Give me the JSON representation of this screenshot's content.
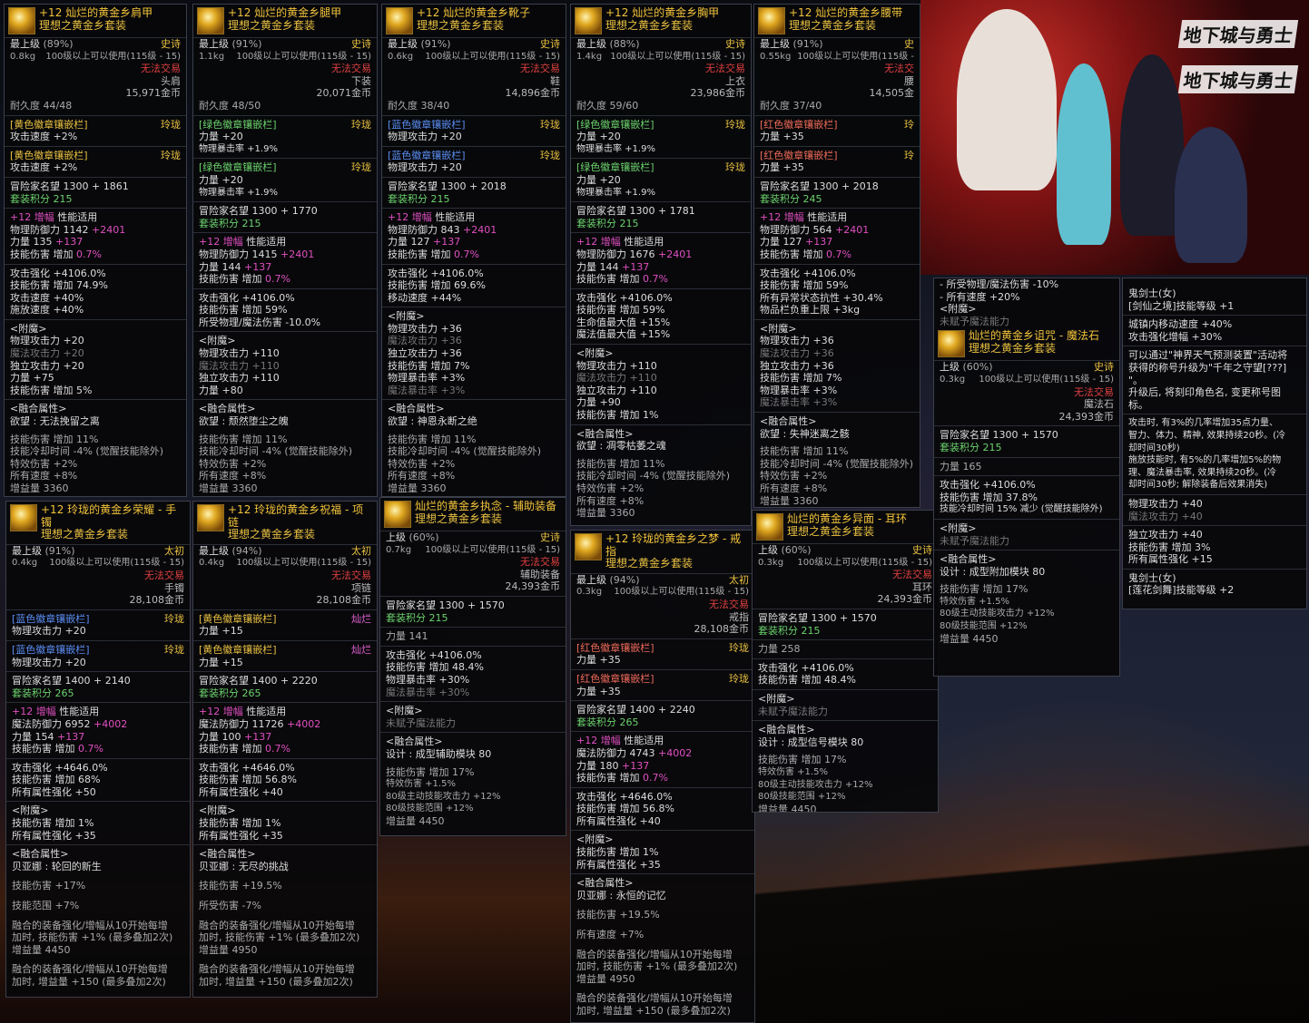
{
  "banner": {
    "logo1": "地下城与勇士",
    "logo2": "地下城与勇士"
  },
  "p1": {
    "title": "+12 灿烂的黄金乡肩甲",
    "set": "理想之黄金乡套装",
    "grade": "最上级",
    "pct": "(89%)",
    "rarity": "史诗",
    "weight": "0.8kg",
    "level_req": "100级以上可以使用(115级 - 15)",
    "trade": "无法交易",
    "slot": "头肩",
    "price": "15,971金币",
    "dur": "耐久度 44/48",
    "s1": "[黄色徽章镶嵌栏]",
    "s1tag": "玲珑",
    "s1v": "攻击速度 +2%",
    "s2": "[黄色徽章镶嵌栏]",
    "s2tag": "玲珑",
    "s2v": "攻击速度 +2%",
    "fame": "冒险家名望 1300 + 1861",
    "setpt": "套装积分 215",
    "amp": "+12 增幅",
    "ampx": "性能适用",
    "l1": "物理防御力 1142",
    "l1b": "+2401",
    "l2": "力量 135",
    "l2b": "+137",
    "l3": "技能伤害 增加",
    "l3b": "0.7%",
    "l4": "攻击强化 +4106.0%",
    "l5": "技能伤害 增加 74.9%",
    "l6": "攻击速度 +40%",
    "l7": "施放速度 +40%",
    "ench": "<附魔>",
    "e1": "物理攻击力 +20",
    "e2": "魔法攻击力 +20",
    "e3": "独立攻击力 +20",
    "e4": "力量 +75",
    "e5": "技能伤害 增加 5%",
    "fuse": "<融合属性>",
    "fuse1": "欲望 : 无法挽留之离",
    "f1": "技能伤害 增加 11%",
    "f2": "技能冷却时间 -4% (觉醒技能除外)",
    "f3": "特效伤害 +2%",
    "f4": "所有速度 +8%",
    "f5": "增益量 3360"
  },
  "p2": {
    "title": "+12 灿烂的黄金乡腿甲",
    "set": "理想之黄金乡套装",
    "grade": "最上级",
    "pct": "(91%)",
    "rarity": "史诗",
    "weight": "1.1kg",
    "level_req": "100级以上可以使用(115级 - 15)",
    "trade": "无法交易",
    "slot": "下装",
    "price": "20,071金币",
    "dur": "耐久度 48/50",
    "s1": "[绿色徽章镶嵌栏]",
    "s1tag": "玲珑",
    "s1v": "力量 +20",
    "s1w": "物理暴击率 +1.9%",
    "s2": "[绿色徽章镶嵌栏]",
    "s2tag": "玲珑",
    "s2v": "力量 +20",
    "s2w": "物理暴击率 +1.9%",
    "fame": "冒险家名望 1300 + 1770",
    "setpt": "套装积分 215",
    "amp": "+12 增幅",
    "ampx": "性能适用",
    "l1": "物理防御力 1415",
    "l1b": "+2401",
    "l2": "力量 144",
    "l2b": "+137",
    "l3": "技能伤害 增加",
    "l3b": "0.7%",
    "l4": "攻击强化 +4106.0%",
    "l5": "技能伤害 增加 59%",
    "l6": "所受物理/魔法伤害 -10.0%",
    "ench": "<附魔>",
    "e1": "物理攻击力 +110",
    "e2": "魔法攻击力 +110",
    "e3": "独立攻击力 +110",
    "e4": "力量 +80",
    "fuse": "<融合属性>",
    "fuse1": "欲望 : 颓然堕尘之魄",
    "f1": "技能伤害 增加 11%",
    "f2": "技能冷却时间 -4% (觉醒技能除外)",
    "f3": "特效伤害 +2%",
    "f4": "所有速度 +8%",
    "f5": "增益量 3360"
  },
  "p3": {
    "title": "+12 灿烂的黄金乡靴子",
    "set": "理想之黄金乡套装",
    "grade": "最上级",
    "pct": "(91%)",
    "rarity": "史诗",
    "weight": "0.6kg",
    "level_req": "100级以上可以使用(115级 - 15)",
    "trade": "无法交易",
    "slot": "鞋",
    "price": "14,896金币",
    "dur": "耐久度 38/40",
    "s1": "[蓝色徽章镶嵌栏]",
    "s1tag": "玲珑",
    "s1v": "物理攻击力 +20",
    "s2": "[蓝色徽章镶嵌栏]",
    "s2tag": "玲珑",
    "s2v": "物理攻击力 +20",
    "fame": "冒险家名望 1300 + 2018",
    "setpt": "套装积分 215",
    "amp": "+12 增幅",
    "ampx": "性能适用",
    "l1": "物理防御力 843",
    "l1b": "+2401",
    "l2": "力量 127",
    "l2b": "+137",
    "l3": "技能伤害 增加",
    "l3b": "0.7%",
    "l4": "攻击强化 +4106.0%",
    "l5": "技能伤害 增加 69.6%",
    "l6": "移动速度 +44%",
    "ench": "<附魔>",
    "e1": "物理攻击力 +36",
    "e2": "魔法攻击力 +36",
    "e3": "独立攻击力 +36",
    "e4": "技能伤害 增加 7%",
    "e5": "物理暴击率 +3%",
    "e6": "魔法暴击率 +3%",
    "fuse": "<融合属性>",
    "fuse1": "欲望 : 神恩永断之绝",
    "f1": "技能伤害 增加 11%",
    "f2": "技能冷却时间 -4% (觉醒技能除外)",
    "f3": "特效伤害 +2%",
    "f4": "所有速度 +8%",
    "f5": "增益量 3360"
  },
  "p4": {
    "title": "+12 灿烂的黄金乡胸甲",
    "set": "理想之黄金乡套装",
    "grade": "最上级",
    "pct": "(88%)",
    "rarity": "史诗",
    "weight": "1.4kg",
    "level_req": "100级以上可以使用(115级 - 15)",
    "trade": "无法交易",
    "slot": "上衣",
    "price": "23,986金币",
    "dur": "耐久度 59/60",
    "s1": "[绿色徽章镶嵌栏]",
    "s1tag": "玲珑",
    "s1v": "力量 +20",
    "s1w": "物理暴击率 +1.9%",
    "s2": "[绿色徽章镶嵌栏]",
    "s2tag": "玲珑",
    "s2v": "力量 +20",
    "s2w": "物理暴击率 +1.9%",
    "fame": "冒险家名望 1300 + 1781",
    "setpt": "套装积分 215",
    "amp": "+12 增幅",
    "ampx": "性能适用",
    "l1": "物理防御力 1676",
    "l1b": "+2401",
    "l2": "力量 144",
    "l2b": "+137",
    "l3": "技能伤害 增加",
    "l3b": "0.7%",
    "l4": "攻击强化 +4106.0%",
    "l5": "技能伤害 增加 59%",
    "l6": "生命值最大值 +15%",
    "l7": "魔法值最大值 +15%",
    "ench": "<附魔>",
    "e1": "物理攻击力 +110",
    "e2": "魔法攻击力 +110",
    "e3": "独立攻击力 +110",
    "e4": "力量 +90",
    "e5": "技能伤害 增加 1%",
    "fuse": "<融合属性>",
    "fuse1": "欲望 : 凋零枯萎之魂",
    "f1": "技能伤害 增加 11%",
    "f2": "技能冷却时间 -4% (觉醒技能除外)",
    "f3": "特效伤害 +2%",
    "f4": "所有速度 +8%",
    "f5": "增益量 3360"
  },
  "p5": {
    "title": "+12 灿烂的黄金乡腰带",
    "set": "理想之黄金乡套装",
    "grade": "最上级",
    "pct": "(91%)",
    "rarity": "史",
    "weight": "0.55kg",
    "level_req": "100级以上可以使用(115级 -",
    "trade": "无法交",
    "slot": "腰",
    "price": "14,505金",
    "dur": "耐久度 37/40",
    "s1": "[红色徽章镶嵌栏]",
    "s1tag": "玲",
    "s1v": "力量 +35",
    "s2": "[红色徽章镶嵌栏]",
    "s2tag": "玲",
    "s2v": "力量 +35",
    "fame": "冒险家名望 1300 + 2018",
    "setpt": "套装积分 245",
    "amp": "+12 增幅",
    "ampx": "性能适用",
    "l1": "物理防御力 564",
    "l1b": "+2401",
    "l2": "力量 127",
    "l2b": "+137",
    "l3": "技能伤害 增加",
    "l3b": "0.7%",
    "l4": "攻击强化 +4106.0%",
    "l5": "技能伤害 增加 59%",
    "l6": "所有异常状态抗性 +30.4%",
    "l7": "物品栏负重上限 +3kg",
    "ench": "<附魔>",
    "e1": "物理攻击力 +36",
    "e2": "魔法攻击力 +36",
    "e3": "独立攻击力 +36",
    "e4": "技能伤害 增加 7%",
    "e5": "物理暴击率 +3%",
    "e6": "魔法暴击率 +3%",
    "fuse": "<融合属性>",
    "fuse1": "欲望 : 失神迷离之骸",
    "f1": "技能伤害 增加 11%",
    "f2": "技能冷却时间 -4% (觉醒技能除外)",
    "f3": "特效伤害 +2%",
    "f4": "所有速度 +8%",
    "f5": "增益量 3360"
  },
  "p6": {
    "title": "+12 玲珑的黄金乡荣耀 - 手镯",
    "set": "理想之黄金乡套装",
    "grade": "最上级",
    "pct": "(91%)",
    "rarity": "太初",
    "weight": "0.4kg",
    "level_req": "100级以上可以使用(115级 - 15)",
    "trade": "无法交易",
    "slot": "手镯",
    "price": "28,108金币",
    "s1": "[蓝色徽章镶嵌栏]",
    "s1tag": "玲珑",
    "s1v": "物理攻击力 +20",
    "s2": "[蓝色徽章镶嵌栏]",
    "s2tag": "玲珑",
    "s2v": "物理攻击力 +20",
    "fame": "冒险家名望 1400 + 2140",
    "setpt": "套装积分 265",
    "amp": "+12 增幅",
    "ampx": "性能适用",
    "l1": "魔法防御力 6952",
    "l1b": "+4002",
    "l2": "力量 154",
    "l2b": "+137",
    "l3": "技能伤害 增加",
    "l3b": "0.7%",
    "l4": "攻击强化 +4646.0%",
    "l5": "技能伤害 增加 68%",
    "l6": "所有属性强化 +50",
    "ench": "<附魔>",
    "e1": "技能伤害 增加 1%",
    "e2": "所有属性强化 +35",
    "fuse": "<融合属性>",
    "fuse1": "贝亚娜 : 轮回的新生",
    "f1": "技能伤害 +17%",
    "f2": "技能范围 +7%",
    "g1": "融合的装备强化/增幅从10开始每增",
    "g2": "加时, 技能伤害 +1% (最多叠加2次)",
    "g3": "增益量 4450",
    "h1": "融合的装备强化/增幅从10开始每增",
    "h2": "加时, 增益量 +150 (最多叠加2次)"
  },
  "p7": {
    "title": "+12 玲珑的黄金乡祝福 - 项链",
    "set": "理想之黄金乡套装",
    "grade": "最上级",
    "pct": "(94%)",
    "rarity": "太初",
    "weight": "0.4kg",
    "level_req": "100级以上可以使用(115级 - 15)",
    "trade": "无法交易",
    "slot": "项链",
    "price": "28,108金币",
    "s1": "[黄色徽章镶嵌栏]",
    "s1tag": "灿烂",
    "s1v": "力量 +15",
    "s2": "[黄色徽章镶嵌栏]",
    "s2tag": "灿烂",
    "s2v": "力量 +15",
    "fame": "冒险家名望 1400 + 2220",
    "setpt": "套装积分 265",
    "amp": "+12 增幅",
    "ampx": "性能适用",
    "l1": "魔法防御力 11726",
    "l1b": "+4002",
    "l2": "力量 100",
    "l2b": "+137",
    "l3": "技能伤害 增加",
    "l3b": "0.7%",
    "l4": "攻击强化 +4646.0%",
    "l5": "技能伤害 增加 56.8%",
    "l6": "所有属性强化 +40",
    "ench": "<附魔>",
    "e1": "技能伤害 增加 1%",
    "e2": "所有属性强化 +35",
    "fuse": "<融合属性>",
    "fuse1": "贝亚娜 : 无尽的挑战",
    "f1": "技能伤害 +19.5%",
    "f2": "所受伤害 -7%",
    "g1": "融合的装备强化/增幅从10开始每增",
    "g2": "加时, 技能伤害 +1% (最多叠加2次)",
    "g3": "增益量 4950",
    "h1": "融合的装备强化/增幅从10开始每增",
    "h2": "加时, 增益量 +150 (最多叠加2次)"
  },
  "p8": {
    "title": "灿烂的黄金乡执念 - 辅助装备",
    "set": "理想之黄金乡套装",
    "grade": "上级",
    "pct": "(60%)",
    "rarity": "史诗",
    "weight": "0.7kg",
    "level_req": "100级以上可以使用(115级 - 15)",
    "trade": "无法交易",
    "slot": "辅助装备",
    "price": "24,393金币",
    "fame": "冒险家名望 1300 + 1570",
    "setpt": "套装积分 215",
    "l0": "力量 141",
    "l4": "攻击强化 +4106.0%",
    "l5": "技能伤害 增加 48.4%",
    "l6": "物理暴击率 +30%",
    "l7": "魔法暴击率 +30%",
    "ench": "<附魔>",
    "e1": "未赋予魔法能力",
    "fuse": "<融合属性>",
    "fuse1": "设计 : 成型辅助模块 80",
    "f1": "技能伤害 增加 17%",
    "f2": "特效伤害 +1.5%",
    "f3": "80级主动技能攻击力 +12%",
    "f4": "80级技能范围 +12%",
    "f5": "增益量 4450"
  },
  "p9": {
    "title": "+12 玲珑的黄金乡之梦 - 戒指",
    "set": "理想之黄金乡套装",
    "grade": "最上级",
    "pct": "(94%)",
    "rarity": "太初",
    "weight": "0.3kg",
    "level_req": "100级以上可以使用(115级 - 15)",
    "trade": "无法交易",
    "slot": "戒指",
    "price": "28,108金币",
    "s1": "[红色徽章镶嵌栏]",
    "s1tag": "玲珑",
    "s1v": "力量 +35",
    "s2": "[红色徽章镶嵌栏]",
    "s2tag": "玲珑",
    "s2v": "力量 +35",
    "fame": "冒险家名望 1400 + 2240",
    "setpt": "套装积分 265",
    "amp": "+12 增幅",
    "ampx": "性能适用",
    "l1": "魔法防御力 4743",
    "l1b": "+4002",
    "l2": "力量 180",
    "l2b": "+137",
    "l3": "技能伤害 增加",
    "l3b": "0.7%",
    "l4": "攻击强化 +4646.0%",
    "l5": "技能伤害 增加 56.8%",
    "l6": "所有属性强化 +40",
    "ench": "<附魔>",
    "e1": "技能伤害 增加 1%",
    "e2": "所有属性强化 +35",
    "fuse": "<融合属性>",
    "fuse1": "贝亚娜 : 永恒的记忆",
    "f1": "技能伤害 +19.5%",
    "f2": "所有速度 +7%",
    "g1": "融合的装备强化/增幅从10开始每增",
    "g2": "加时, 技能伤害 +1% (最多叠加2次)",
    "g3": "增益量 4950",
    "h1": "融合的装备强化/增幅从10开始每增",
    "h2": "加时, 增益量 +150 (最多叠加2次)"
  },
  "p10": {
    "title": "灿烂的黄金乡异面 - 耳环",
    "set": "理想之黄金乡套装",
    "grade": "上级",
    "pct": "(60%)",
    "rarity": "史诗",
    "weight": "0.3kg",
    "level_req": "100级以上可以使用(115级 - 15)",
    "trade": "无法交易",
    "slot": "耳环",
    "price": "24,393金币",
    "fame": "冒险家名望 1300 + 1570",
    "setpt": "套装积分 215",
    "l0": "力量 258",
    "l4": "攻击强化 +4106.0%",
    "l5": "技能伤害 增加 48.4%",
    "ench": "<附魔>",
    "e1": "未赋予魔法能力",
    "fuse": "<融合属性>",
    "fuse1": "设计 : 成型信号模块 80",
    "f1": "技能伤害 增加 17%",
    "f2": "特效伤害 +1.5%",
    "f3": "80级主动技能攻击力 +12%",
    "f4": "80级技能范围 +12%",
    "f5": "增益量 4450"
  },
  "p11": {
    "top1": "- 所受物理/魔法伤害 -10%",
    "top2": "- 所有速度 +20%",
    "ench": "<附魔>",
    "e1": "未赋予魔法能力",
    "title": "灿烂的黄金乡诅咒 - 魔法石",
    "set": "理想之黄金乡套装",
    "grade": "上级",
    "pct": "(60%)",
    "rarity": "史诗",
    "weight": "0.3kg",
    "level_req": "100级以上可以使用(115级 - 15)",
    "trade": "无法交易",
    "slot": "魔法石",
    "price": "24,393金币",
    "fame": "冒险家名望 1300 + 1570",
    "setpt": "套装积分 215",
    "l0": "力量 165",
    "l4": "攻击强化 +4106.0%",
    "l5": "技能伤害 增加 37.8%",
    "l6": "技能冷却时间 15% 减少 (觉醒技能除外)",
    "ench2": "<附魔>",
    "e2": "未赋予魔法能力",
    "fuse": "<融合属性>",
    "fuse1": "设计 : 成型附加模块 80",
    "f1": "技能伤害 增加 17%",
    "f2": "特效伤害 +1.5%",
    "f3": "80级主动技能攻击力 +12%",
    "f4": "80级技能范围 +12%",
    "f5": "增益量 4450"
  },
  "p12": {
    "t1": "鬼剑士(女)",
    "t2": "[剑仙之境]技能等级 +1",
    "t3": "城镇内移动速度 +40%",
    "t4": "攻击强化增幅 +30%",
    "t5": "可以通过\"神界天气预测装置\"活动将",
    "t6": "获得的称号升级为\"千年之守望[???]",
    "t7": "\"。",
    "t8": "升级后, 将刻印角色名, 变更称号图",
    "t9": "标。",
    "t10": "攻击时, 有3%的几率增加35点力量、",
    "t11": "智力、体力、精神, 效果持续20秒。(冷",
    "t12": "却时间30秒)",
    "t13": "施放技能时, 有5%的几率增加5%的物",
    "t14": "理、魔法暴击率, 效果持续20秒。(冷",
    "t15": "却时间30秒; 解除装备后效果消失)",
    "t16": "物理攻击力 +40",
    "t17": "魔法攻击力 +40",
    "t18": "独立攻击力 +40",
    "t19": "技能伤害 增加 3%",
    "t20": "所有属性强化 +15",
    "t21": "鬼剑士(女)",
    "t22": "[莲花剑舞]技能等级 +2"
  }
}
